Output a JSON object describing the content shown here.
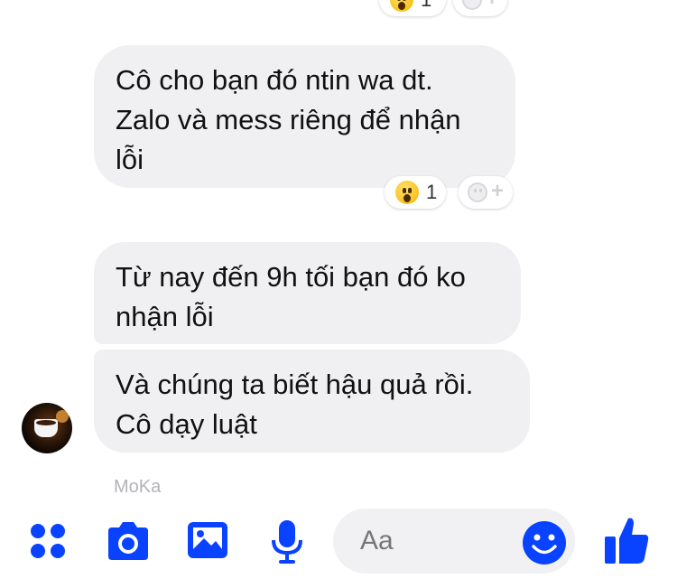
{
  "messages": [
    {
      "text": "Cô cho bạn đó ntin wa dt.\nZalo và mess riêng để nhận\nlỗi",
      "reaction_count": "1"
    },
    {
      "text": "Từ nay đến 9h tối bạn đó ko\nnhận lỗi"
    },
    {
      "text": "Và chúng ta biết hậu quả rồi.\nCô dạy luật"
    }
  ],
  "top_reaction_count": "1",
  "sender_name": "MoKa",
  "composer": {
    "placeholder": "Aa",
    "icons": [
      "apps-icon",
      "camera-icon",
      "image-icon",
      "microphone-icon",
      "emoji-icon",
      "thumbs-up-icon"
    ]
  },
  "colors": {
    "accent": "#0a43ff",
    "bubble": "#f0f0f2"
  }
}
